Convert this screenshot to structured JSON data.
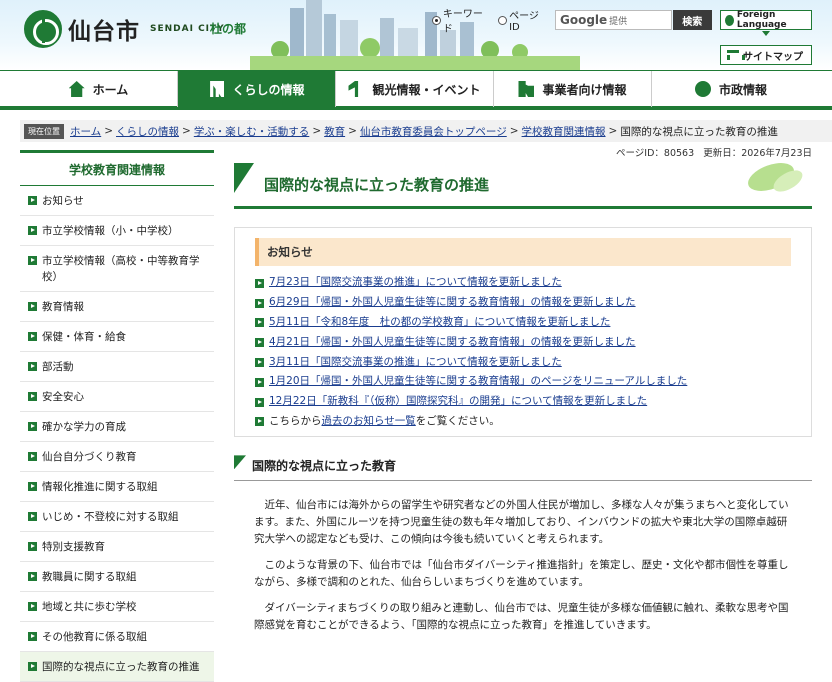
{
  "header": {
    "logo_text": "仙台市",
    "logo_sub": "SENDAI CITY",
    "logo_mori": "杜の都",
    "radio_keyword": "キーワード",
    "radio_pageid": "ページID",
    "search_google": "Google",
    "search_placeholder": "提供",
    "search_button": "検索",
    "foreign_language": "Foreign Language",
    "sitemap": "サイトマップ"
  },
  "nav": [
    {
      "label": "ホーム",
      "icon": "house-icon"
    },
    {
      "label": "くらしの情報",
      "icon": "people-icon"
    },
    {
      "label": "観光情報・イベント",
      "icon": "tourist-icon"
    },
    {
      "label": "事業者向け情報",
      "icon": "business-icon"
    },
    {
      "label": "市政情報",
      "icon": "city-icon"
    }
  ],
  "breadcrumb": {
    "label": "現在位置",
    "links": [
      "ホーム",
      "くらしの情報",
      "学ぶ・楽しむ・活動する",
      "教育",
      "仙台市教育委員会トップページ",
      "学校教育関連情報"
    ],
    "current": "国際的な視点に立った教育の推進"
  },
  "sidebar": {
    "title": "学校教育関連情報",
    "items": [
      "お知らせ",
      "市立学校情報（小・中学校）",
      "市立学校情報（高校・中等教育学校）",
      "教育情報",
      "保健・体育・給食",
      "部活動",
      "安全安心",
      "確かな学力の育成",
      "仙台自分づくり教育",
      "情報化推進に関する取組",
      "いじめ・不登校に対する取組",
      "特別支援教育",
      "教職員に関する取組",
      "地域と共に歩む学校",
      "その他教育に係る取組",
      "国際的な視点に立った教育の推進"
    ]
  },
  "main": {
    "page_id": "ページID：80563",
    "updated": "更新日：2026年7月23日",
    "title": "国際的な視点に立った教育の推進",
    "notice_head": "お知らせ",
    "notices": [
      "7月23日「国際交流事業の推進」について情報を更新しました",
      "6月29日「帰国・外国人児童生徒等に関する教育情報」の情報を更新しました",
      "5月11日「令和8年度　杜の都の学校教育」について情報を更新しました",
      "4月21日「帰国・外国人児童生徒等に関する教育情報」の情報を更新しました",
      "3月11日「国際交流事業の推進」について情報を更新しました",
      "1月20日「帰国・外国人児童生徒等に関する教育情報」のページをリニューアルしました",
      "12月22日「新教科『（仮称）国際探究科』の開発」について情報を更新しました"
    ],
    "past_prefix": "こちらから",
    "past_link": "過去のお知らせ一覧",
    "past_suffix": "をご覧ください。",
    "section_title": "国際的な視点に立った教育",
    "paragraphs": [
      "近年、仙台市には海外からの留学生や研究者などの外国人住民が増加し、多様な人々が集うまちへと変化しています。また、外国にルーツを持つ児童生徒の数も年々増加しており、インバウンドの拡大や東北大学の国際卓越研究大学への認定なども受け、この傾向は今後も続いていくと考えられます。",
      "このような背景の下、仙台市では「仙台市ダイバーシティ推進指針」を策定し、歴史・文化や都市個性を尊重しながら、多様で調和のとれた、仙台らしいまちづくりを進めています。",
      "ダイバーシティまちづくりの取り組みと連動し、仙台市では、児童生徒が多様な価値観に触れ、柔軟な思考や国際感覚を育むことができるよう、「国際的な視点に立った教育」を推進していきます。"
    ]
  }
}
